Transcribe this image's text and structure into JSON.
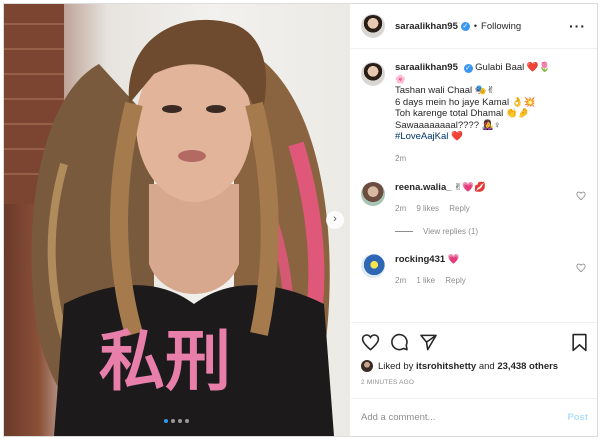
{
  "header": {
    "username": "saraalikhan95",
    "separator": "•",
    "follow_status": "Following",
    "more": "···"
  },
  "photo": {
    "shirt_text": "私刑",
    "next_arrow": "›",
    "dots": [
      true,
      false,
      false,
      false
    ]
  },
  "caption": {
    "username": "saraalikhan95",
    "lines": [
      "Gulabi Baal ❤️🌷",
      "🌸",
      "Tashan wali Chaal 🎭✌",
      "6 days mein ho jaye Kamal 👌💥",
      "Toh karenge total Dhamal 👏🤌",
      "Sawaaaaaaaal???? 👩‍🎤♀",
      "#LoveAajKal ❤️"
    ],
    "time": "2m"
  },
  "comments": [
    {
      "username": "reena.walia_",
      "text": "✌💗💋",
      "time": "2m",
      "likes": "9 likes",
      "reply": "Reply"
    },
    {
      "username": "rocking431",
      "text": "💗",
      "time": "2m",
      "likes": "1 like",
      "reply": "Reply"
    }
  ],
  "view_replies": "View replies (1)",
  "likes": {
    "prefix": "Liked by",
    "user": "itsrohitshetty",
    "and": "and",
    "count": "23,438 others"
  },
  "timestamp": "2 MINUTES AGO",
  "add_comment": {
    "placeholder": "Add a comment...",
    "post": "Post"
  },
  "colors": {
    "accent": "#3897f0",
    "muted": "#8e8e8e",
    "hashtag": "#003569",
    "post_disabled": "#b2dffc",
    "hair_pink": "#e8567f"
  }
}
